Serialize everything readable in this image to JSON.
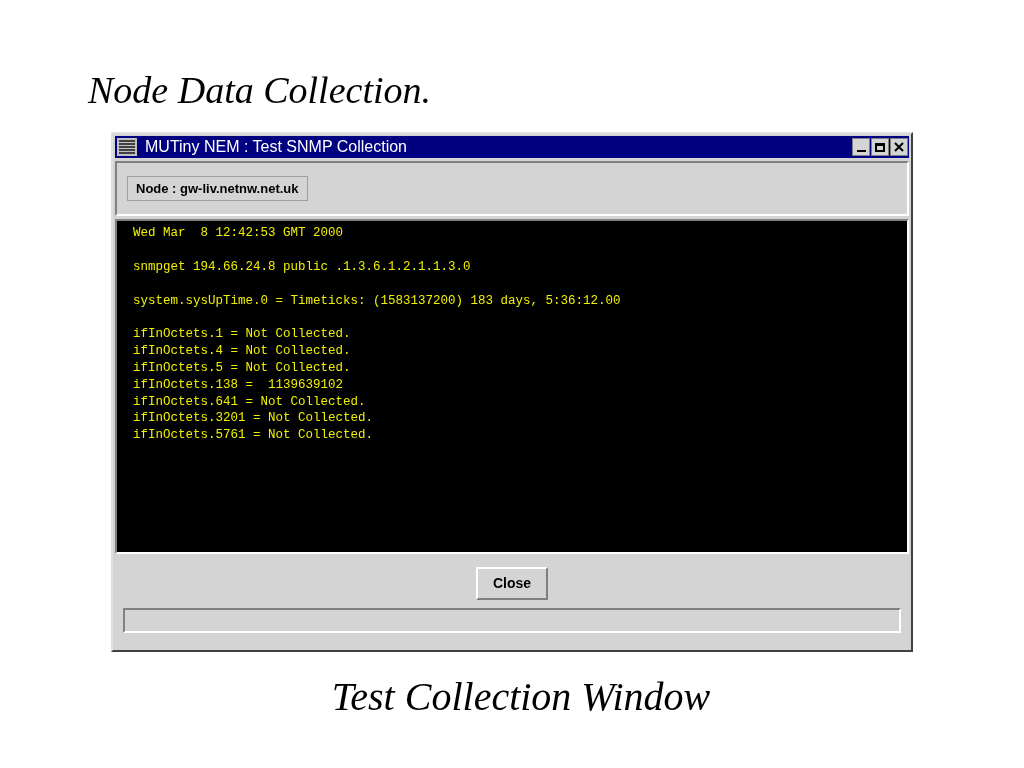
{
  "slide_title": "Node Data Collection.",
  "window": {
    "title": "MUTiny NEM : Test SNMP Collection"
  },
  "node_label": "Node : gw-liv.netnw.net.uk",
  "output_blocks": [
    [
      "Wed Mar  8 12:42:53 GMT 2000"
    ],
    [
      "snmpget 194.66.24.8 public .1.3.6.1.2.1.1.3.0"
    ],
    [
      "system.sysUpTime.0 = Timeticks: (1583137200) 183 days, 5:36:12.00"
    ],
    [
      "ifInOctets.1 = Not Collected.",
      "ifInOctets.4 = Not Collected.",
      "ifInOctets.5 = Not Collected.",
      "ifInOctets.138 =  1139639102",
      "ifInOctets.641 = Not Collected.",
      "ifInOctets.3201 = Not Collected.",
      "ifInOctets.5761 = Not Collected."
    ]
  ],
  "buttons": [
    "Close"
  ],
  "caption": "Test Collection Window"
}
